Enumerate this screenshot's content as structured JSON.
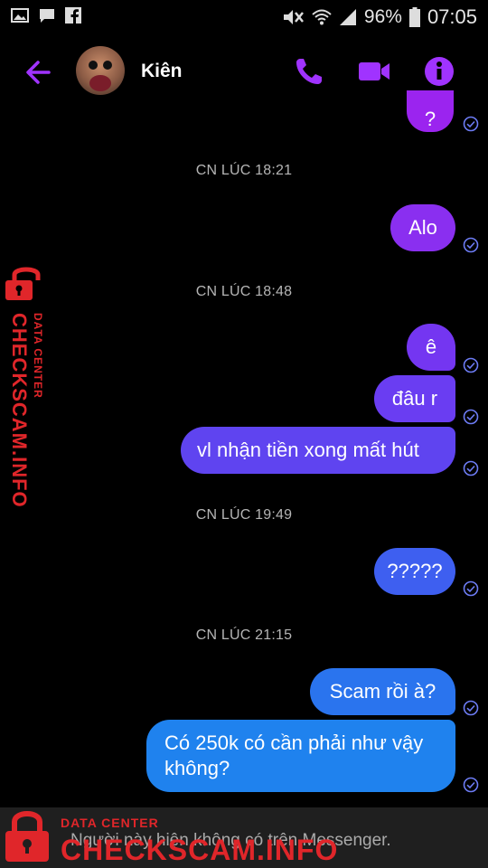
{
  "status_bar": {
    "battery": "96%",
    "time": "07:05",
    "icons": [
      "gallery-icon",
      "chat-icon",
      "facebook-icon",
      "mute-icon",
      "wifi-icon",
      "signal-icon",
      "battery-icon"
    ]
  },
  "header": {
    "contact_name": "Kiên",
    "icons": [
      "back-arrow-icon",
      "phone-icon",
      "video-icon",
      "info-icon"
    ],
    "accent_color": "#a033ff"
  },
  "conversation": {
    "timestamps": [
      "CN LÚC 18:21",
      "CN LÚC 18:48",
      "CN LÚC 19:49",
      "CN LÚC 21:15"
    ],
    "messages": [
      {
        "text": "?",
        "color": "#9b24ef"
      },
      {
        "text": "Alo",
        "color": "#8a2ff0"
      },
      {
        "text": "ê",
        "color": "#7436f1"
      },
      {
        "text": "đâu r",
        "color": "#6a3df2"
      },
      {
        "text": "vl nhận tiền xong mất hút",
        "color": "#5f44f0"
      },
      {
        "text": "?????",
        "color": "#3e5ff0"
      },
      {
        "text": "Scam rồi à?",
        "color": "#2a74ee"
      },
      {
        "text": "Có 250k có cần phải như vậy không?",
        "color": "#1f82ee"
      }
    ]
  },
  "footer": {
    "notice": "Người này hiện không có trên Messenger."
  },
  "watermark": {
    "label": "DATA CENTER",
    "site": "CHECKSCAM.INFO"
  }
}
